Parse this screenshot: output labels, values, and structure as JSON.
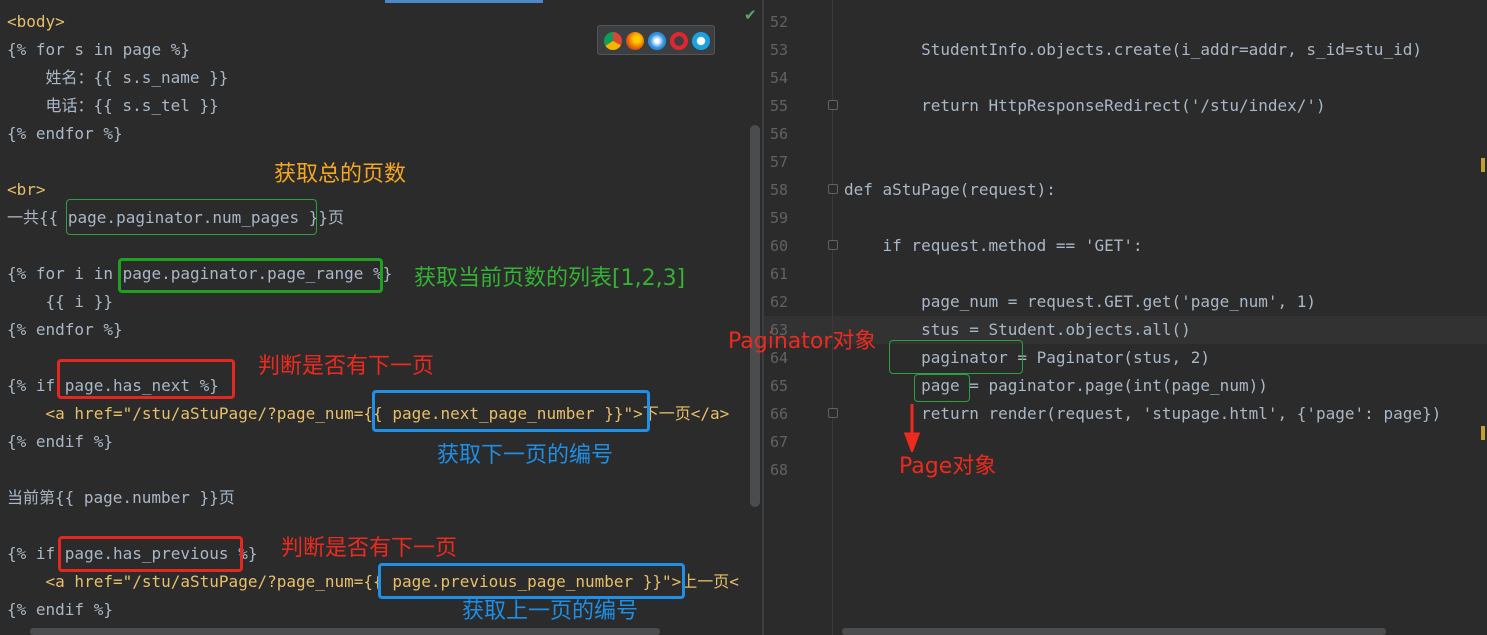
{
  "left": {
    "lines": [
      "<body>",
      "{% for s in page %}",
      "    姓名：{{ s.s_name }}",
      "    电话：{{ s.s_tel }}",
      "{% endfor %}",
      "",
      "<br>",
      "一共{{ page.paginator.num_pages }}页",
      "",
      "{% for i in page.paginator.page_range %}",
      "    {{ i }}",
      "{% endfor %}",
      "",
      "{% if page.has_next %}",
      "    <a href=\"/stu/aStuPage/?page_num={{ page.next_page_number }}\">下一页</a>",
      "{% endif %}",
      "",
      "当前第{{ page.number }}页",
      "",
      "{% if page.has_previous %}",
      "    <a href=\"/stu/aStuPage/?page_num={{ page.previous_page_number }}\">上一页<",
      "{% endif %}"
    ],
    "annotations": {
      "total_pages": "获取总的页数",
      "page_list": "获取当前页数的列表[1,2,3]",
      "has_next": "判断是否有下一页",
      "next_number": "获取下一页的编号",
      "has_previous": "判断是否有下一页",
      "previous_number": "获取上一页的编号"
    }
  },
  "right": {
    "line_numbers": [
      "52",
      "53",
      "54",
      "55",
      "56",
      "57",
      "58",
      "59",
      "60",
      "61",
      "62",
      "63",
      "64",
      "65",
      "66",
      "67",
      "68"
    ],
    "lines": [
      "",
      "        StudentInfo.objects.create(i_addr=addr, s_id=stu_id)",
      "",
      "        return HttpResponseRedirect('/stu/index/')",
      "",
      "",
      "def aStuPage(request):",
      "",
      "    if request.method == 'GET':",
      "",
      "        page_num = request.GET.get('page_num', 1)",
      "        stus = Student.objects.all()",
      "        paginator = Paginator(stus, 2)",
      "        page = paginator.page(int(page_num))",
      "        return render(request, 'stupage.html', {'page': page})",
      "",
      ""
    ],
    "annotations": {
      "paginator_obj": "Paginator对象",
      "page_obj": "Page对象"
    }
  },
  "colors": {
    "red": "#ee2a1f",
    "green": "#34b233",
    "blue": "#1e8fe6",
    "orange": "#f5a623",
    "editor_bg": "#2b2b2b"
  },
  "icons": [
    "chrome-icon",
    "firefox-icon",
    "safari-icon",
    "opera-icon",
    "ie-icon",
    "check-icon"
  ]
}
